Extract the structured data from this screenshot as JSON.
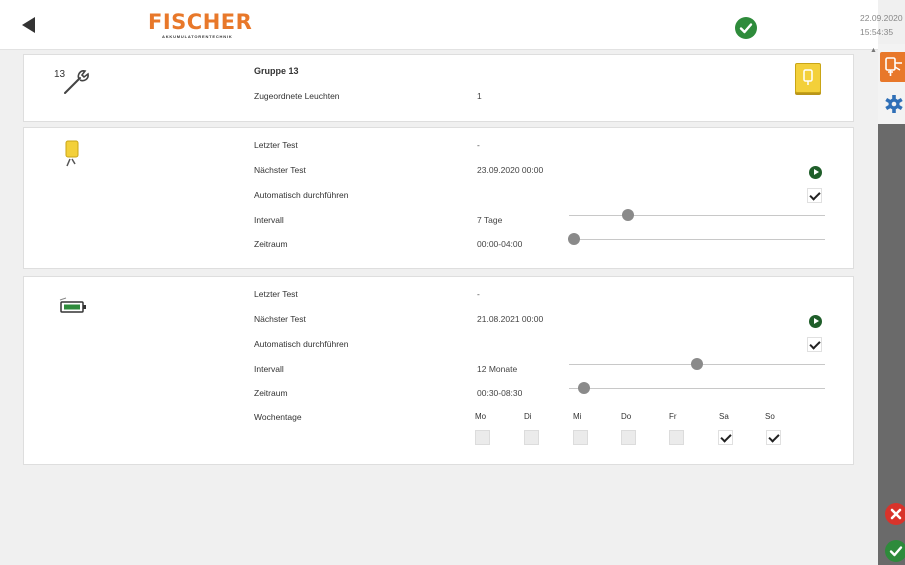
{
  "header": {
    "back_icon": "back-arrow-icon",
    "logo_name": "FISCHER",
    "logo_tagline": "AKKUMULATORENTECHNIK",
    "status_icon": "check-circle-icon",
    "date": "22.09.2020",
    "time": "15:54:35"
  },
  "sidebar": {
    "light_icon": "luminaire-icon",
    "settings_icon": "gear-icon",
    "cancel_icon": "cancel-icon",
    "confirm_icon": "confirm-icon"
  },
  "group": {
    "icon": "wrench-group-icon",
    "icon_number": "13",
    "title": "Gruppe 13",
    "assigned_label": "Zugeordnete Leuchten",
    "assigned_value": "1",
    "lamp_button_icon": "lamp-icon"
  },
  "function_test": {
    "icon": "function-test-icon",
    "last_test_label": "Letzter Test",
    "last_test_value": "-",
    "next_test_label": "Nächster Test",
    "next_test_value": "23.09.2020 00:00",
    "auto_label": "Automatisch durchführen",
    "auto_checked": true,
    "interval_label": "Intervall",
    "interval_value": "7 Tage",
    "interval_slider_fraction": 0.23,
    "period_label": "Zeitraum",
    "period_value": "00:00-04:00",
    "period_slider_fraction": 0.02
  },
  "duration_test": {
    "icon": "battery-test-icon",
    "last_test_label": "Letzter Test",
    "last_test_value": "-",
    "next_test_label": "Nächster Test",
    "next_test_value": "21.08.2021 00:00",
    "auto_label": "Automatisch durchführen",
    "auto_checked": true,
    "interval_label": "Intervall",
    "interval_value": "12 Monate",
    "interval_slider_fraction": 0.5,
    "period_label": "Zeitraum",
    "period_value": "00:30-08:30",
    "period_slider_fraction": 0.06,
    "weekdays_label": "Wochentage",
    "weekdays": [
      {
        "label": "Mo",
        "checked": false
      },
      {
        "label": "Di",
        "checked": false
      },
      {
        "label": "Mi",
        "checked": false
      },
      {
        "label": "Do",
        "checked": false
      },
      {
        "label": "Fr",
        "checked": false
      },
      {
        "label": "Sa",
        "checked": true
      },
      {
        "label": "So",
        "checked": true
      }
    ]
  },
  "colors": {
    "brand_orange": "#e8782a",
    "ok_green": "#2e8b3b",
    "cancel_red": "#d8332b",
    "settings_blue": "#2f6fb7",
    "lamp_yellow": "#f3d03a"
  }
}
